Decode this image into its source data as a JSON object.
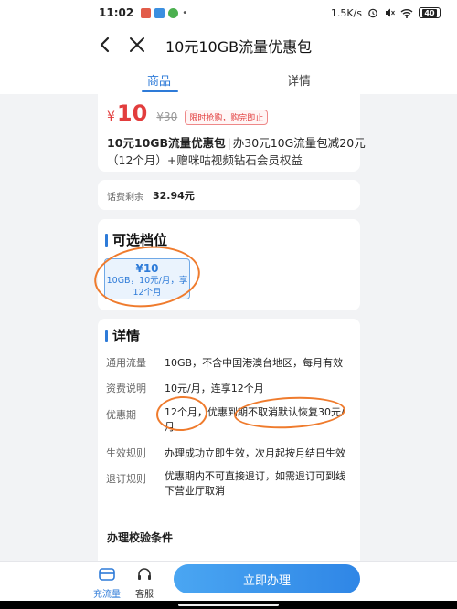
{
  "status_bar": {
    "time": "11:02",
    "network_speed": "1.5K/s",
    "battery": "40"
  },
  "header": {
    "title": "10元10GB流量优惠包",
    "back_icon": "chevron-left-icon",
    "close_icon": "close-icon"
  },
  "tabs": [
    {
      "label": "商品",
      "active": true
    },
    {
      "label": "详情",
      "active": false
    }
  ],
  "price_card": {
    "currency": "¥",
    "price": "10",
    "original_price": "¥30",
    "promo_badge": "限时抢购，购完即止",
    "product_name": "10元10GB流量优惠包",
    "separator": "|",
    "desc_line1": "办30元10G流量包减20元",
    "desc_line2": "（12个月）+赠咪咕视频钻石会员权益"
  },
  "balance": {
    "label": "话费剩余",
    "value": "32.94元"
  },
  "tier_section": {
    "title": "可选档位",
    "option_price": "¥10",
    "option_desc_1": "10GB，10元/月，享",
    "option_desc_2": "12个月"
  },
  "detail_section": {
    "title": "详情",
    "rows": [
      {
        "label": "通用流量",
        "value": "10GB，不含中国港澳台地区，每月有效"
      },
      {
        "label": "资费说明",
        "value": "10元/月，连享12个月"
      },
      {
        "label": "优惠期",
        "value": "12个月，优惠到期不取消默认恢复30元/月"
      },
      {
        "label": "生效规则",
        "value": "办理成功立即生效，次月起按月结日生效"
      },
      {
        "label": "退订规则",
        "value": "优惠期内不可直接退订，如需退订可到线下营业厅取消"
      }
    ]
  },
  "conditions": {
    "title": "办理校验条件"
  },
  "bottom_bar": {
    "recharge_label": "充流量",
    "service_label": "客服",
    "cta_label": "立即办理"
  },
  "colors": {
    "accent": "#2e7bd8",
    "price_red": "#e23d3d",
    "annotation_orange": "#ef7b2d"
  }
}
